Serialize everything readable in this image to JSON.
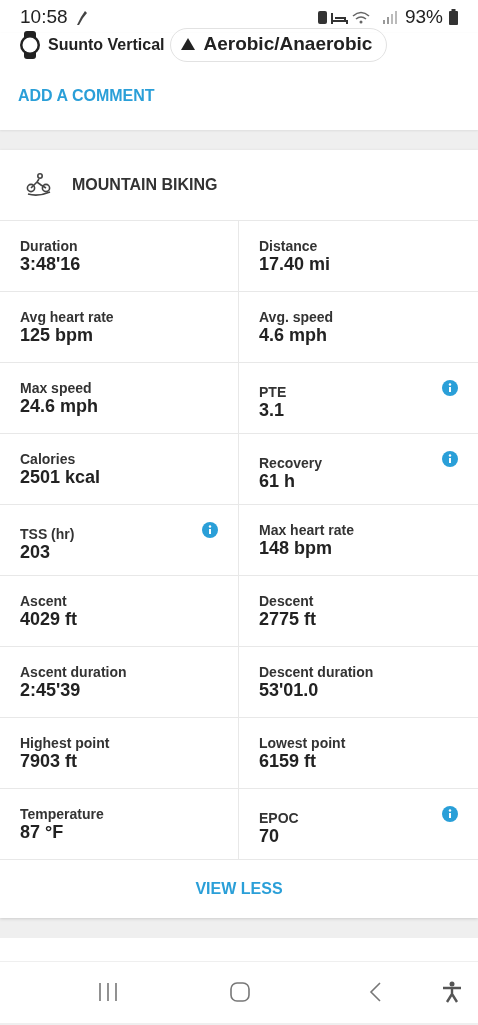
{
  "status_bar": {
    "time": "10:58",
    "battery": "93%"
  },
  "device": {
    "name": "Suunto Vertical",
    "chip": "Aerobic/Anaerobic"
  },
  "comment_link": "ADD A COMMENT",
  "activity": {
    "title": "MOUNTAIN BIKING"
  },
  "stats": [
    {
      "label": "Duration",
      "value": "3:48'16",
      "info": false
    },
    {
      "label": "Distance",
      "value": "17.40 mi",
      "info": false
    },
    {
      "label": "Avg heart rate",
      "value": "125 bpm",
      "info": false
    },
    {
      "label": "Avg. speed",
      "value": "4.6 mph",
      "info": false
    },
    {
      "label": "Max speed",
      "value": "24.6 mph",
      "info": false
    },
    {
      "label": "PTE",
      "value": "3.1",
      "info": true
    },
    {
      "label": "Calories",
      "value": "2501 kcal",
      "info": false
    },
    {
      "label": "Recovery",
      "value": "61 h",
      "info": true
    },
    {
      "label": "TSS (hr)",
      "value": "203",
      "info": true
    },
    {
      "label": "Max heart rate",
      "value": "148 bpm",
      "info": false
    },
    {
      "label": "Ascent",
      "value": "4029 ft",
      "info": false
    },
    {
      "label": "Descent",
      "value": "2775 ft",
      "info": false
    },
    {
      "label": "Ascent duration",
      "value": "2:45'39",
      "info": false
    },
    {
      "label": "Descent duration",
      "value": "53'01.0",
      "info": false
    },
    {
      "label": "Highest point",
      "value": "7903 ft",
      "info": false
    },
    {
      "label": "Lowest point",
      "value": "6159 ft",
      "info": false
    },
    {
      "label": "Temperature",
      "value": "87 °F",
      "info": false
    },
    {
      "label": "EPOC",
      "value": "70",
      "info": true
    }
  ],
  "view_less": "VIEW LESS"
}
